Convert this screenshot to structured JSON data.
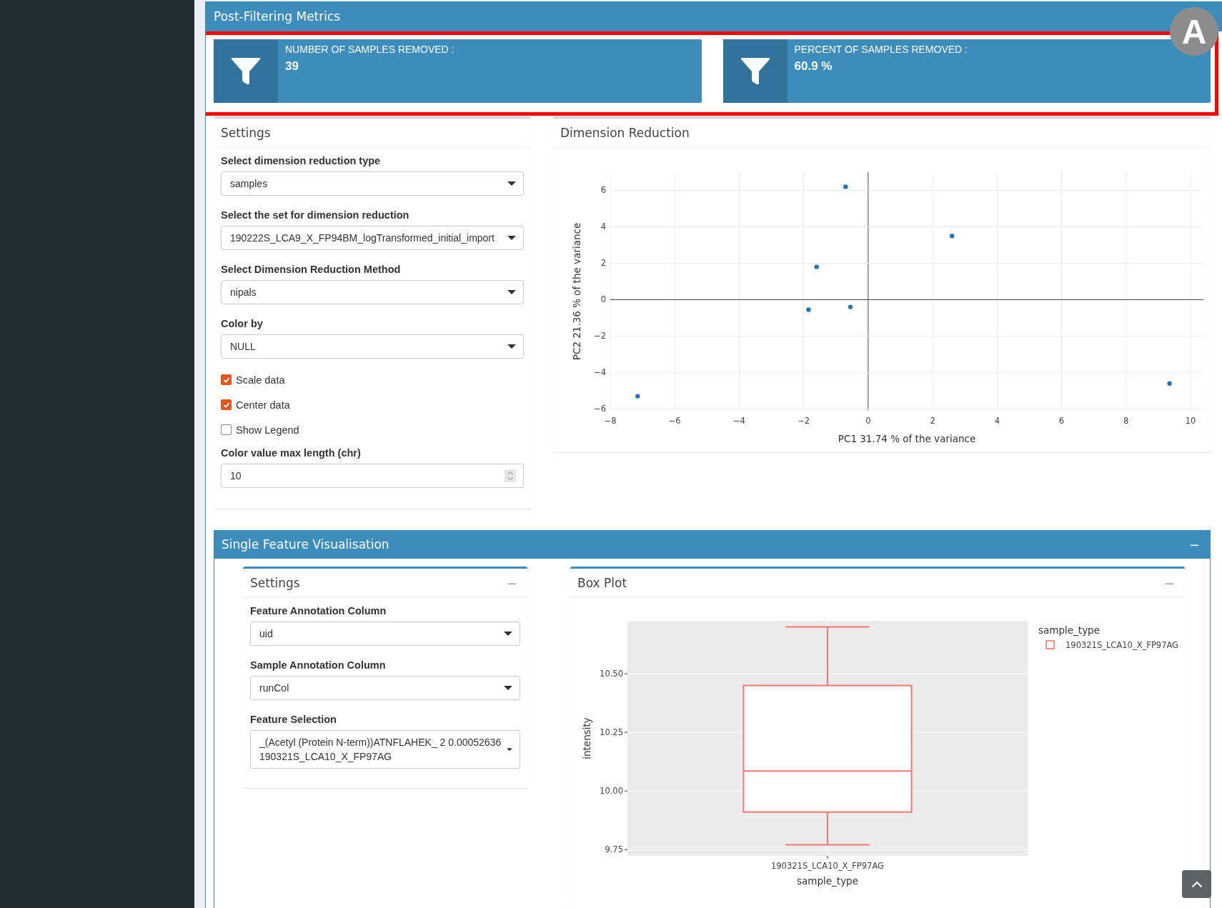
{
  "annotation": {
    "label": "A"
  },
  "metrics": {
    "title": "Post-Filtering Metrics",
    "info_boxes": [
      {
        "label": "NUMBER OF SAMPLES REMOVED :",
        "value": "39"
      },
      {
        "label": "PERCENT OF SAMPLES REMOVED :",
        "value": "60.9 %"
      }
    ]
  },
  "settings": {
    "title": "Settings",
    "fields": [
      {
        "kind": "select",
        "label": "Select dimension reduction type",
        "value": "samples"
      },
      {
        "kind": "select",
        "label": "Select the set for dimension reduction",
        "value": "190222S_LCA9_X_FP94BM_logTransformed_initial_import"
      },
      {
        "kind": "select",
        "label": "Select Dimension Reduction Method",
        "value": "nipals"
      },
      {
        "kind": "select",
        "label": "Color by",
        "value": "NULL"
      },
      {
        "kind": "checkbox",
        "label": "Scale data",
        "checked": true
      },
      {
        "kind": "checkbox",
        "label": "Center data",
        "checked": true
      },
      {
        "kind": "checkbox",
        "label": "Show Legend",
        "checked": false
      },
      {
        "kind": "number",
        "label": "Color value max length (chr)",
        "value": "10"
      }
    ]
  },
  "dimension_reduction": {
    "title": "Dimension Reduction",
    "chart_data": {
      "type": "scatter",
      "xlabel": "PC1 31.74 % of the variance",
      "ylabel": "PC2 21.36 % of the variance",
      "x": [
        -0.7,
        2.6,
        -1.6,
        -1.85,
        -0.55,
        -7.15,
        9.35
      ],
      "grid": true,
      "series": [
        {
          "color": "#1f77b4",
          "values": [
            6.2,
            3.5,
            1.8,
            -0.55,
            -0.4,
            -5.3,
            -4.6
          ]
        }
      ],
      "xlim": [
        -8,
        10.4
      ],
      "ylim": [
        -6.1,
        7
      ],
      "xticks": [
        {
          "value": -8,
          "label": "−8"
        },
        {
          "value": -6,
          "label": "−6"
        },
        {
          "value": -4,
          "label": "−4"
        },
        {
          "value": -2,
          "label": "−2"
        },
        {
          "value": 0,
          "label": "0"
        },
        {
          "value": 2,
          "label": "2"
        },
        {
          "value": 4,
          "label": "4"
        },
        {
          "value": 6,
          "label": "6"
        },
        {
          "value": 8,
          "label": "8"
        },
        {
          "value": 10,
          "label": "10"
        }
      ],
      "yticks": [
        {
          "value": -6,
          "label": "−6"
        },
        {
          "value": -4,
          "label": "−4"
        },
        {
          "value": -2,
          "label": "−2"
        },
        {
          "value": 0,
          "label": "0"
        },
        {
          "value": 2,
          "label": "2"
        },
        {
          "value": 4,
          "label": "4"
        },
        {
          "value": 6,
          "label": "6"
        }
      ]
    }
  },
  "single_feature": {
    "title": "Single Feature Visualisation",
    "collapse": "−",
    "settings": {
      "title": "Settings",
      "collapse": "−",
      "fields": [
        {
          "kind": "select",
          "label": "Feature Annotation Column",
          "value": "uid"
        },
        {
          "kind": "select",
          "label": "Sample Annotation Column",
          "value": "runCol"
        },
        {
          "kind": "select",
          "label": "Feature Selection",
          "value": "_(Acetyl (Protein N-term))ATNFLAHEK_ 2 0.00052636 190321S_LCA10_X_FP97AG"
        }
      ]
    },
    "box_plot": {
      "title": "Box Plot",
      "collapse": "−",
      "chart_data": {
        "type": "candlestick",
        "grid": true,
        "xlabel": "sample_type",
        "ylabel": "intensity",
        "legend_title": "sample_type",
        "categories": [
          "190321S_LCA10_X_FP97AG"
        ],
        "series": [
          {
            "name": "190321S_LCA10_X_FP97AG",
            "color": "#f8766d",
            "ohlc": [
              [
                9.91,
                10.7,
                9.77,
                10.45
              ]
            ]
          }
        ],
        "ref_lines": [
          {
            "axis": "y",
            "value": 10.085,
            "color": "#f8766d"
          }
        ],
        "ylim": [
          9.723,
          10.726
        ],
        "yticks": [
          {
            "value": 9.75,
            "label": "9.75"
          },
          {
            "value": 10,
            "label": "10.00"
          },
          {
            "value": 10.25,
            "label": "10.25"
          },
          {
            "value": 10.5,
            "label": "10.50"
          }
        ]
      }
    }
  }
}
